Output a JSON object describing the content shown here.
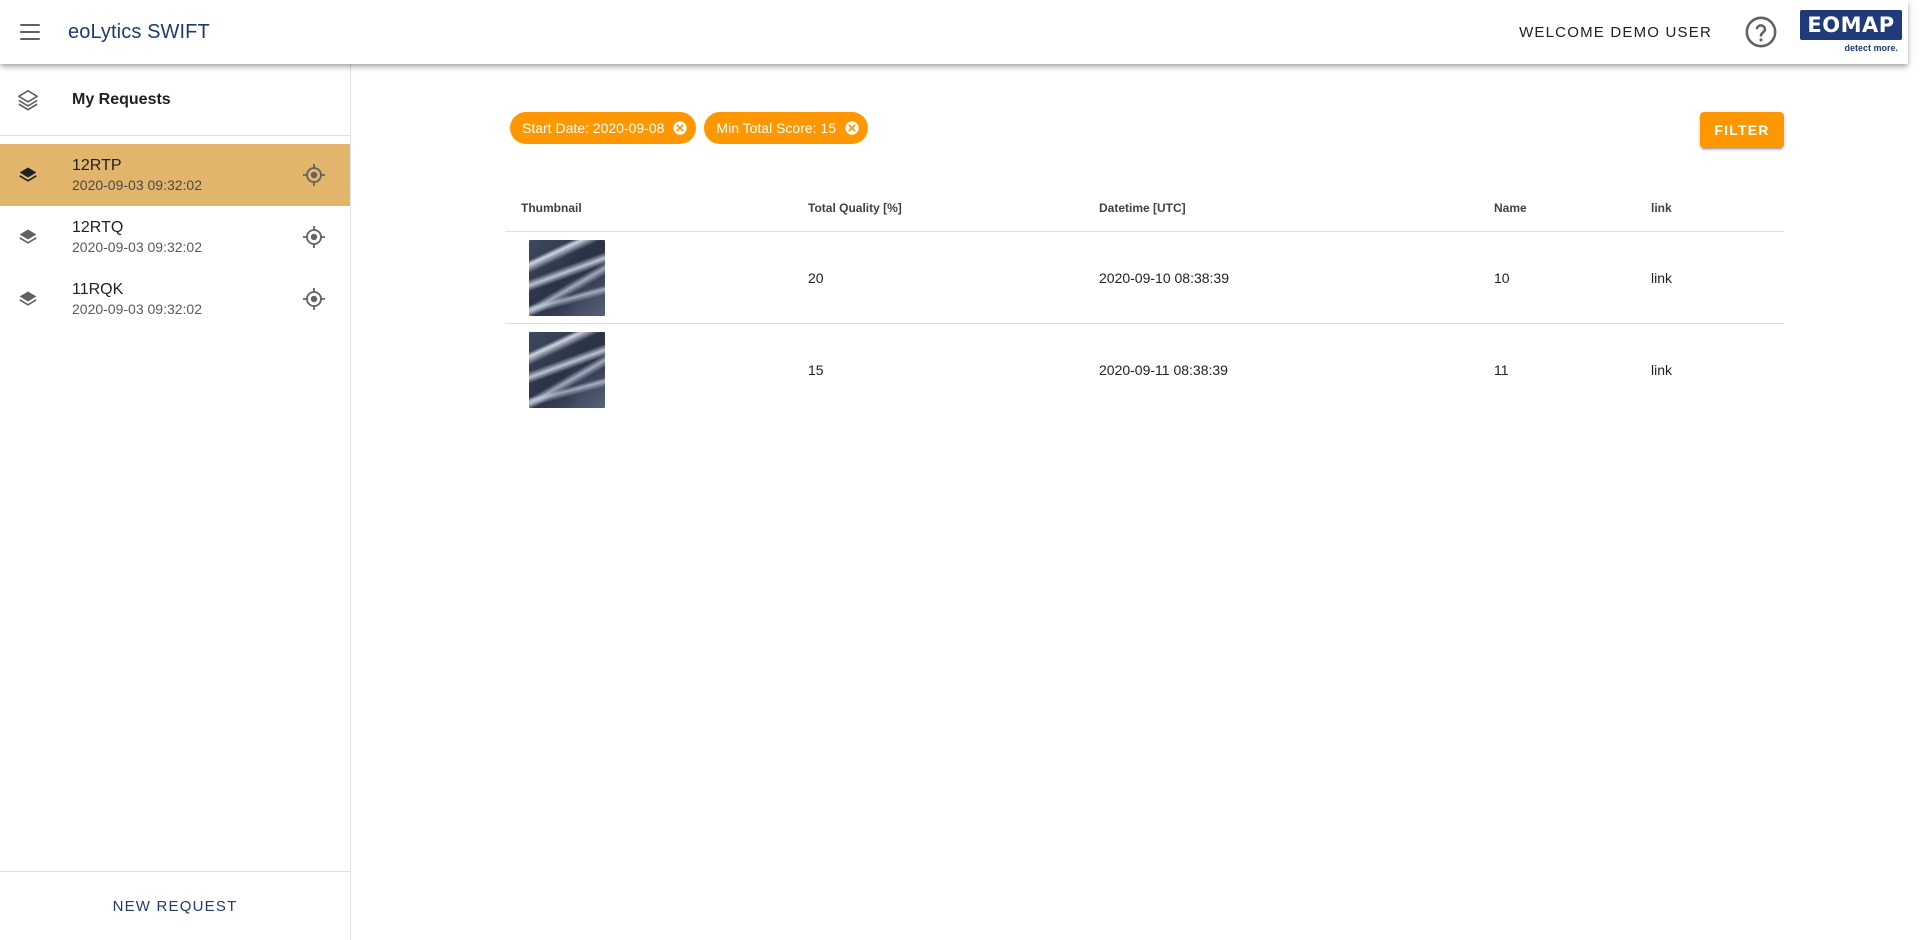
{
  "header": {
    "app_title": "eoLytics SWIFT",
    "welcome": "WELCOME DEMO USER",
    "logo_text": "EOMAP",
    "logo_tagline": "detect more.",
    "brand_color": "#1f3b7a"
  },
  "sidebar": {
    "title": "My Requests",
    "requests": [
      {
        "name": "12RTP",
        "date": "2020-09-03 09:32:02",
        "active": true
      },
      {
        "name": "12RTQ",
        "date": "2020-09-03 09:32:02",
        "active": false
      },
      {
        "name": "11RQK",
        "date": "2020-09-03 09:32:02",
        "active": false
      }
    ],
    "new_request_label": "NEW REQUEST",
    "active_color": "#e2b56d"
  },
  "filters": {
    "chips": [
      {
        "label": "Start Date: 2020-09-08"
      },
      {
        "label": "Min Total Score: 15"
      }
    ],
    "filter_button": "FILTER",
    "accent_color": "#ff9800"
  },
  "table": {
    "columns": [
      "Thumbnail",
      "Total Quality [%]",
      "Datetime [UTC]",
      "Name",
      "link"
    ],
    "rows": [
      {
        "quality": "20",
        "datetime": "2020-09-10 08:38:39",
        "name": "10",
        "link": "link"
      },
      {
        "quality": "15",
        "datetime": "2020-09-11 08:38:39",
        "name": "11",
        "link": "link"
      }
    ]
  }
}
